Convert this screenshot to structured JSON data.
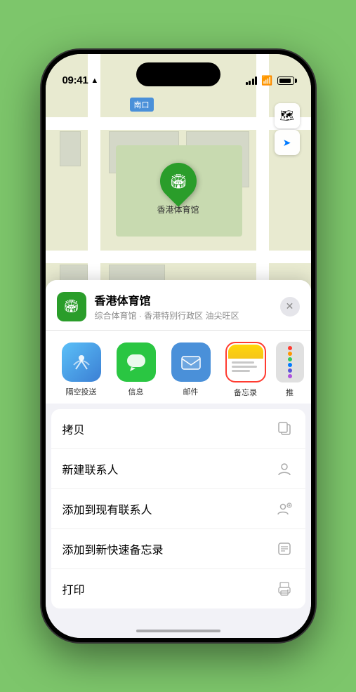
{
  "status_bar": {
    "time": "09:41",
    "location_arrow": "▶"
  },
  "map": {
    "north_label": "南口",
    "venue_name": "香港体育馆",
    "venue_emoji": "🏟"
  },
  "map_controls": {
    "map_icon": "🗺",
    "location_icon": "➤"
  },
  "sheet": {
    "venue_name": "香港体育馆",
    "venue_subtitle": "综合体育馆 · 香港特别行政区 油尖旺区",
    "close_label": "✕"
  },
  "share_actions": [
    {
      "id": "airdrop",
      "label": "隔空投送",
      "type": "airdrop"
    },
    {
      "id": "messages",
      "label": "信息",
      "type": "messages"
    },
    {
      "id": "mail",
      "label": "邮件",
      "type": "mail"
    },
    {
      "id": "notes",
      "label": "备忘录",
      "type": "notes",
      "selected": true
    },
    {
      "id": "more",
      "label": "推",
      "type": "more"
    }
  ],
  "action_items": [
    {
      "label": "拷贝",
      "icon": "copy"
    },
    {
      "label": "新建联系人",
      "icon": "person"
    },
    {
      "label": "添加到现有联系人",
      "icon": "person-add"
    },
    {
      "label": "添加到新快速备忘录",
      "icon": "note"
    },
    {
      "label": "打印",
      "icon": "print"
    }
  ],
  "more_dots": {
    "colors": [
      "#ff3b30",
      "#ff9500",
      "#34c759",
      "#007aff",
      "#5856d6",
      "#af52de"
    ]
  }
}
